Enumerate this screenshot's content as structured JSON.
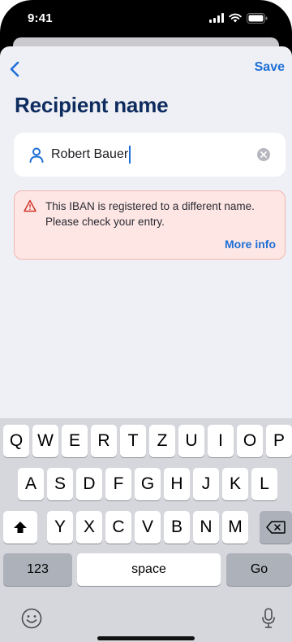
{
  "status_bar": {
    "time": "9:41"
  },
  "nav": {
    "save_label": "Save"
  },
  "page": {
    "title": "Recipient name"
  },
  "name_field": {
    "value": "Robert Bauer"
  },
  "error": {
    "message": "This IBAN is registered to a different name. Please check your entry.",
    "more_info_label": "More info"
  },
  "keyboard": {
    "row1": [
      "Q",
      "W",
      "E",
      "R",
      "T",
      "Z",
      "U",
      "I",
      "O",
      "P"
    ],
    "row2": [
      "A",
      "S",
      "D",
      "F",
      "G",
      "H",
      "J",
      "K",
      "L"
    ],
    "row3": [
      "Y",
      "X",
      "C",
      "V",
      "B",
      "N",
      "M"
    ],
    "numbers_label": "123",
    "space_label": "space",
    "go_label": "Go"
  },
  "colors": {
    "accent": "#1d6fd6",
    "title": "#0d2b5e",
    "error_bg": "#fde6e4",
    "error_border": "#f3b6b1",
    "warning_icon": "#d2362b"
  }
}
